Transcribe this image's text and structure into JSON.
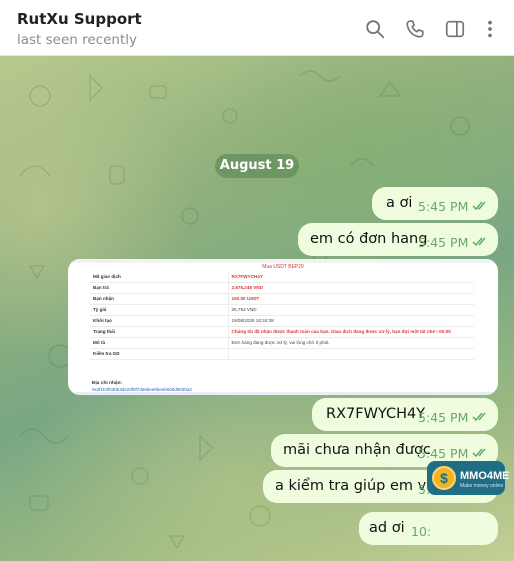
{
  "header": {
    "title": "RutXu Support",
    "status": "last seen recently"
  },
  "chat": {
    "date_label": "August 19",
    "messages": [
      {
        "text": "a ơi",
        "time": "5:45 PM"
      },
      {
        "text": "em có đơn hang",
        "time": "5:45 PM"
      },
      {
        "text": "RX7FWYCH4Y",
        "time": "5:45 PM"
      },
      {
        "text": "mãi chưa nhận được",
        "time": "5:45 PM"
      },
      {
        "text": "a kiểm tra giúp em với",
        "time": "5:45 PM"
      },
      {
        "text": "ad ơi",
        "time": "10:"
      }
    ],
    "photo": {
      "title": "Mua USDT BEP20",
      "rows": [
        {
          "label": "Mã giao dịch",
          "value": "RX7FWYCH4Y"
        },
        {
          "label": "Bạn trả",
          "value": "2,675,248 VND"
        },
        {
          "label": "Bạn nhận",
          "value": "100.00 USDT"
        },
        {
          "label": "Tỷ giá",
          "value": "26,753 VND"
        },
        {
          "label": "Khởi tạo",
          "value": "19/08/2025 16:34:38"
        },
        {
          "label": "Trạng thái",
          "value": "Chúng tôi đã nhận được thanh toán của bạn. Giao dịch đang được xử lý, bạn đợi một tát nhé ! 00:00"
        },
        {
          "label": "Mô tả",
          "value": "Đơn hàng đang được xử lý, vui lòng chờ ít phút."
        },
        {
          "label": "Kiểm tra GD",
          "value": ""
        }
      ],
      "wallet_label": "Địa chỉ nhận:",
      "wallet_address": "0x2f1b2f030b3d223f0f7de6bee6beeb0ebd90d0a2"
    }
  },
  "watermark": {
    "name": "MMO4ME",
    "sub": "Make money online"
  },
  "colors": {
    "bubble_out": "#effdde",
    "time_text": "#6aa86a",
    "date_pill": "#608c5a"
  }
}
